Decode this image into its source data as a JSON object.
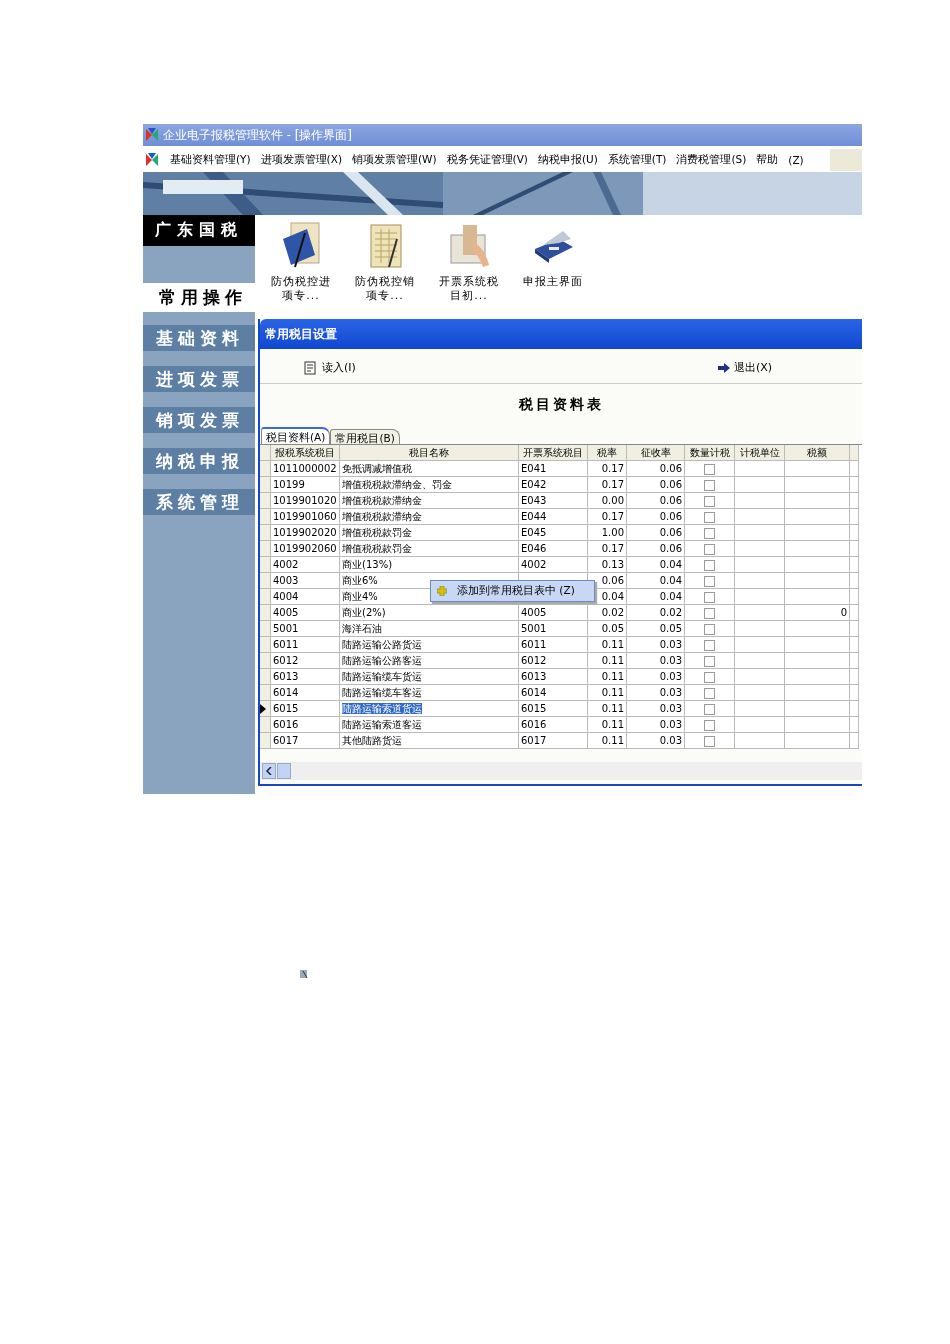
{
  "window": {
    "title": "企业电子报税管理软件 - [操作界面]"
  },
  "menu": [
    "基础资料管理(Y)",
    "进项发票管理(X)",
    "销项发票管理(W)",
    "税务凭证管理(V)",
    "纳税申报(U)",
    "系统管理(T)",
    "消费税管理(S)",
    "帮助",
    "(Z)"
  ],
  "sidebar": {
    "brand": "广东国税",
    "section": "常用操作",
    "items": [
      "基础资料",
      "进项发票",
      "销项发票",
      "纳税申报",
      "系统管理"
    ]
  },
  "shortcuts": [
    {
      "kind": "pen",
      "label": "防伪税控进项专..."
    },
    {
      "kind": "ledger",
      "label": "防伪税控销项专..."
    },
    {
      "kind": "book",
      "label": "开票系统税目初..."
    },
    {
      "kind": "scanner",
      "label": "申报主界面"
    }
  ],
  "dialog": {
    "title": "常用税目设置",
    "toolbar": [
      {
        "kind": "read",
        "label": "读入(I)"
      },
      {
        "kind": "exit",
        "label": "退出(X)"
      }
    ],
    "heading": "税目资料表",
    "tabs": [
      {
        "label": "税目资料(A)",
        "selected": true
      },
      {
        "label": "常用税目(B)",
        "selected": false
      }
    ],
    "columns": [
      "报税系统税目",
      "税目名称",
      "开票系统税目",
      "税率",
      "征收率",
      "数量计税",
      "计税单位",
      "税额"
    ],
    "rows": [
      {
        "code": "1011000002",
        "name": "免抵调减增值税",
        "invoice_code": "E041",
        "tax_rate": "0.17",
        "levy_rate": "0.06",
        "checked": false,
        "selected": false
      },
      {
        "code": "10199",
        "name": "增值税税款滞纳金、罚金",
        "invoice_code": "E042",
        "tax_rate": "0.17",
        "levy_rate": "0.06",
        "checked": false,
        "selected": false
      },
      {
        "code": "1019901020",
        "name": "增值税税款滞纳金",
        "invoice_code": "E043",
        "tax_rate": "0.00",
        "levy_rate": "0.06",
        "checked": false,
        "selected": false
      },
      {
        "code": "1019901060",
        "name": "增值税税款滞纳金",
        "invoice_code": "E044",
        "tax_rate": "0.17",
        "levy_rate": "0.06",
        "checked": false,
        "selected": false
      },
      {
        "code": "1019902020",
        "name": "增值税税款罚金",
        "invoice_code": "E045",
        "tax_rate": "1.00",
        "levy_rate": "0.06",
        "checked": false,
        "selected": false
      },
      {
        "code": "1019902060",
        "name": "增值税税款罚金",
        "invoice_code": "E046",
        "tax_rate": "0.17",
        "levy_rate": "0.06",
        "checked": false,
        "selected": false
      },
      {
        "code": "4002",
        "name": "商业(13%)",
        "invoice_code": "4002",
        "tax_rate": "0.13",
        "levy_rate": "0.04",
        "checked": false,
        "selected": false
      },
      {
        "code": "4003",
        "name": "商业6%",
        "tax_rate": "0.06",
        "levy_rate": "0.04",
        "checked": false,
        "selected": false
      },
      {
        "code": "4004",
        "name": "商业4%",
        "tax_rate": "0.04",
        "levy_rate": "0.04",
        "checked": false,
        "selected": false
      },
      {
        "code": "4005",
        "name": "商业(2%)",
        "invoice_code": "4005",
        "tax_rate": "0.02",
        "levy_rate": "0.02",
        "amount": "0",
        "checked": false,
        "selected": false
      },
      {
        "code": "5001",
        "name": "海洋石油",
        "invoice_code": "5001",
        "tax_rate": "0.05",
        "levy_rate": "0.05",
        "checked": false,
        "selected": false
      },
      {
        "code": "6011",
        "name": "陆路运输公路货运",
        "invoice_code": "6011",
        "tax_rate": "0.11",
        "levy_rate": "0.03",
        "checked": false,
        "selected": false
      },
      {
        "code": "6012",
        "name": "陆路运输公路客运",
        "invoice_code": "6012",
        "tax_rate": "0.11",
        "levy_rate": "0.03",
        "checked": false,
        "selected": false
      },
      {
        "code": "6013",
        "name": "陆路运输缆车货运",
        "invoice_code": "6013",
        "tax_rate": "0.11",
        "levy_rate": "0.03",
        "checked": false,
        "selected": false
      },
      {
        "code": "6014",
        "name": "陆路运输缆车客运",
        "invoice_code": "6014",
        "tax_rate": "0.11",
        "levy_rate": "0.03",
        "checked": false,
        "selected": false
      },
      {
        "code": "6015",
        "name": "陆路运输索道货运",
        "invoice_code": "6015",
        "tax_rate": "0.11",
        "levy_rate": "0.03",
        "checked": false,
        "selected": true
      },
      {
        "code": "6016",
        "name": "陆路运输索道客运",
        "invoice_code": "6016",
        "tax_rate": "0.11",
        "levy_rate": "0.03",
        "checked": false,
        "selected": false
      },
      {
        "code": "6017",
        "name": "其他陆路货运",
        "invoice_code": "6017",
        "tax_rate": "0.11",
        "levy_rate": "0.03",
        "checked": false,
        "selected": false
      }
    ],
    "context_menu": {
      "label": "添加到常用税目表中 (Z)"
    }
  }
}
